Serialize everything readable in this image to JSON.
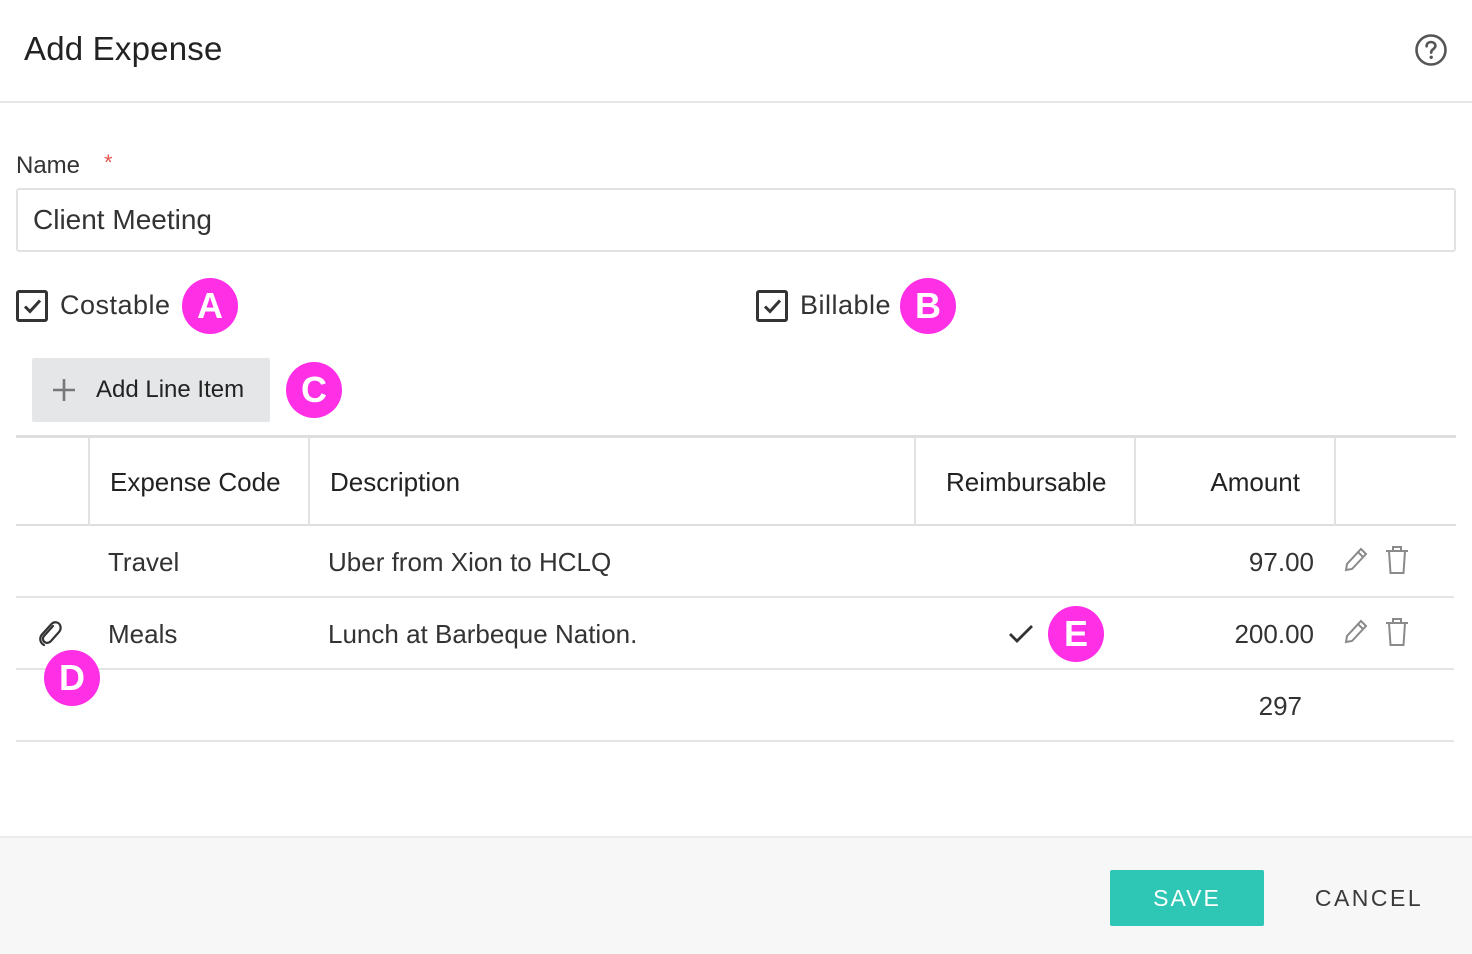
{
  "dialog": {
    "title": "Add Expense",
    "help_icon": "help-circle-icon"
  },
  "form": {
    "name_label": "Name",
    "required_marker": "*",
    "name_value": "Client Meeting",
    "costable": {
      "label": "Costable",
      "checked": true
    },
    "billable": {
      "label": "Billable",
      "checked": true
    },
    "add_line_item_label": "Add Line Item"
  },
  "annotations": [
    "A",
    "B",
    "C",
    "D",
    "E"
  ],
  "table": {
    "headers": [
      "",
      "Expense Code",
      "Description",
      "Reimbursable",
      "Amount",
      ""
    ],
    "rows": [
      {
        "attachment": false,
        "code": "Travel",
        "description": "Uber from Xion to HCLQ",
        "reimbursable": false,
        "amount": "97.00"
      },
      {
        "attachment": true,
        "code": "Meals",
        "description": "Lunch at Barbeque Nation.",
        "reimbursable": true,
        "amount": "200.00"
      }
    ],
    "total": "297"
  },
  "footer": {
    "save_label": "SAVE",
    "cancel_label": "CANCEL"
  },
  "colors": {
    "accent": "#2ec7b6",
    "badge": "#ff2fe6",
    "required": "#e8544e"
  }
}
